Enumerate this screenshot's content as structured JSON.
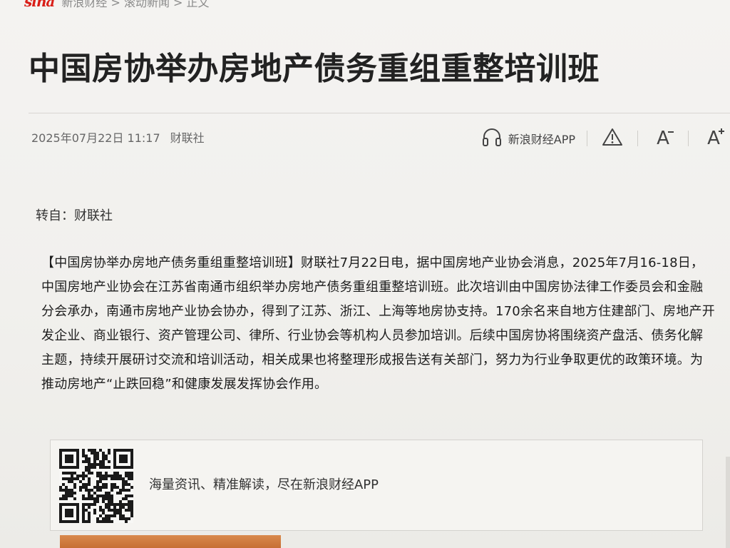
{
  "header": {
    "logo_text": "sina",
    "breadcrumb": "新浪财经 > 滚动新闻 > 正文"
  },
  "article": {
    "title": "中国房协举办房地产债务重组重整培训班",
    "date": "2025年07月22日 11:17",
    "source": "财联社",
    "reprint": "转自：财联社",
    "body": "【中国房协举办房地产债务重组重整培训班】财联社7月22日电，据中国房地产业协会消息，2025年7月16-18日，中国房地产业协会在江苏省南通市组织举办房地产债务重组重整培训班。此次培训由中国房协法律工作委员会和金融分会承办，南通市房地产业协会协办，得到了江苏、浙江、上海等地房协支持。170余名来自地方住建部门、房地产开发企业、商业银行、资产管理公司、律所、行业协会等机构人员参加培训。后续中国房协将围绕资产盘活、债务化解主题，持续开展研讨交流和培训活动，相关成果也将整理形成报告送有关部门，努力为行业争取更优的政策环境。为推动房地产“止跌回稳”和健康发展发挥协会作用。"
  },
  "toolbar": {
    "app_label": "新浪财经APP",
    "font_decrease": "A",
    "font_increase": "A"
  },
  "icons": {
    "app": "headphones-icon",
    "report": "warning-icon",
    "font_decrease": "font-decrease-icon",
    "font_increase": "font-increase-icon",
    "qr": "qr-code-icon"
  },
  "promo": {
    "text": "海量资讯、精准解读，尽在新浪财经APP"
  },
  "colors": {
    "brand_red": "#d91e18",
    "title": "#222222",
    "meta": "#666666",
    "body": "#1c1c1c"
  }
}
